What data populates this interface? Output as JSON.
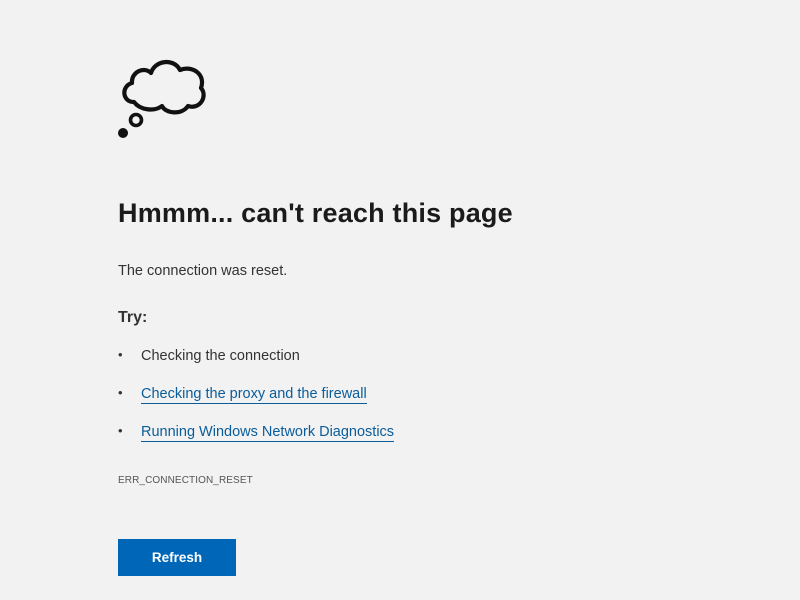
{
  "error_page": {
    "icon": "thought-cloud-icon",
    "title": "Hmmm... can't reach this page",
    "message": "The connection was reset.",
    "try_heading": "Try:",
    "suggestions": [
      {
        "text": "Checking the connection",
        "is_link": false
      },
      {
        "text": "Checking the proxy and the firewall",
        "is_link": true
      },
      {
        "text": "Running Windows Network Diagnostics",
        "is_link": true
      }
    ],
    "error_code": "ERR_CONNECTION_RESET",
    "refresh_label": "Refresh"
  },
  "colors": {
    "background": "#f2f2f2",
    "link": "#0a5c9a",
    "button": "#0067b8",
    "button_text": "#ffffff",
    "heading": "#1b1b1b"
  }
}
